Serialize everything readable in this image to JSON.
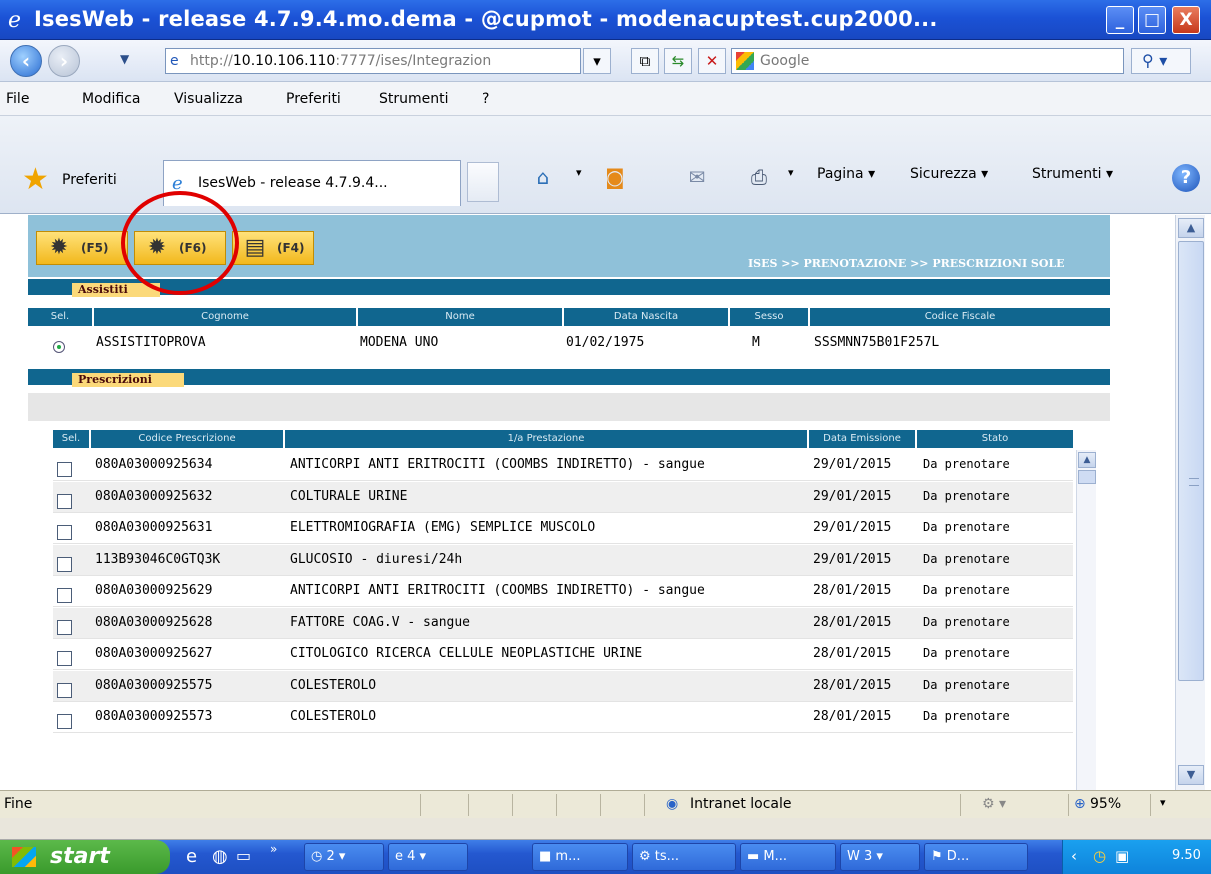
{
  "window": {
    "title": "IsesWeb - release 4.7.9.4.mo.dema - @cupmot - modenacuptest.cup2000...",
    "minimize": "_",
    "maximize": "□",
    "close": "X"
  },
  "addressbar": {
    "url_prefix": "http://",
    "url_host": "10.10.106.110",
    "url_rest": ":7777/ises/Integrazion",
    "search_placeholder": "Google"
  },
  "menu": [
    "File",
    "Modifica",
    "Visualizza",
    "Preferiti",
    "Strumenti",
    "?"
  ],
  "favbar": {
    "favorites": "Preferiti",
    "tab_title": "IsesWeb - release 4.7.9.4...",
    "commands": [
      "Pagina ▾",
      "Sicurezza ▾",
      "Strumenti ▾"
    ]
  },
  "page": {
    "buttons": [
      "(F5)",
      "(F6)",
      "(F4)"
    ],
    "breadcrumb": "ISES >> PRENOTAZIONE >> PRESCRIZIONI SOLE",
    "section_assistiti": "Assistiti",
    "assistiti_headers": [
      "Sel.",
      "Cognome",
      "Nome",
      "Data Nascita",
      "Sesso",
      "Codice Fiscale"
    ],
    "assistito": {
      "cognome": "ASSISTITOPROVA",
      "nome": "MODENA UNO",
      "data_nascita": "01/02/1975",
      "sesso": "M",
      "codice_fiscale": "SSSMNN75B01F257L"
    },
    "section_prescrizioni": "Prescrizioni",
    "prescrizioni_headers": [
      "Sel.",
      "Codice Prescrizione",
      "1/a Prestazione",
      "Data Emissione",
      "Stato"
    ],
    "prescrizioni": [
      {
        "codice": "080A03000925634",
        "prestazione": "ANTICORPI ANTI ERITROCITI (COOMBS INDIRETTO) - sangue",
        "data": "29/01/2015",
        "stato": "Da prenotare"
      },
      {
        "codice": "080A03000925632",
        "prestazione": "COLTURALE URINE",
        "data": "29/01/2015",
        "stato": "Da prenotare"
      },
      {
        "codice": "080A03000925631",
        "prestazione": "ELETTROMIOGRAFIA (EMG) SEMPLICE MUSCOLO",
        "data": "29/01/2015",
        "stato": "Da prenotare"
      },
      {
        "codice": "113B93046C0GTQ3K",
        "prestazione": "GLUCOSIO - diuresi/24h",
        "data": "29/01/2015",
        "stato": "Da prenotare"
      },
      {
        "codice": "080A03000925629",
        "prestazione": "ANTICORPI ANTI ERITROCITI (COOMBS INDIRETTO) - sangue",
        "data": "28/01/2015",
        "stato": "Da prenotare"
      },
      {
        "codice": "080A03000925628",
        "prestazione": "FATTORE COAG.V - sangue",
        "data": "28/01/2015",
        "stato": "Da prenotare"
      },
      {
        "codice": "080A03000925627",
        "prestazione": "CITOLOGICO RICERCA CELLULE NEOPLASTICHE URINE",
        "data": "28/01/2015",
        "stato": "Da prenotare"
      },
      {
        "codice": "080A03000925575",
        "prestazione": "COLESTEROLO",
        "data": "28/01/2015",
        "stato": "Da prenotare"
      },
      {
        "codice": "080A03000925573",
        "prestazione": "COLESTEROLO",
        "data": "28/01/2015",
        "stato": "Da prenotare"
      }
    ]
  },
  "statusbar": {
    "left": "Fine",
    "zone": "Intranet locale",
    "zoom": "95%"
  },
  "taskbar": {
    "start": "start",
    "items": [
      "2 ▾",
      "4 ▾",
      "m...",
      "ts...",
      "M...",
      "3 ▾",
      "D..."
    ],
    "clock": "9.50"
  },
  "colors": {
    "titlebar": "#1b52d6",
    "section_bar": "#10668f",
    "section_label": "#fbd97a",
    "header_band": "#8fc1d9",
    "highlight_circle": "#e00000"
  }
}
